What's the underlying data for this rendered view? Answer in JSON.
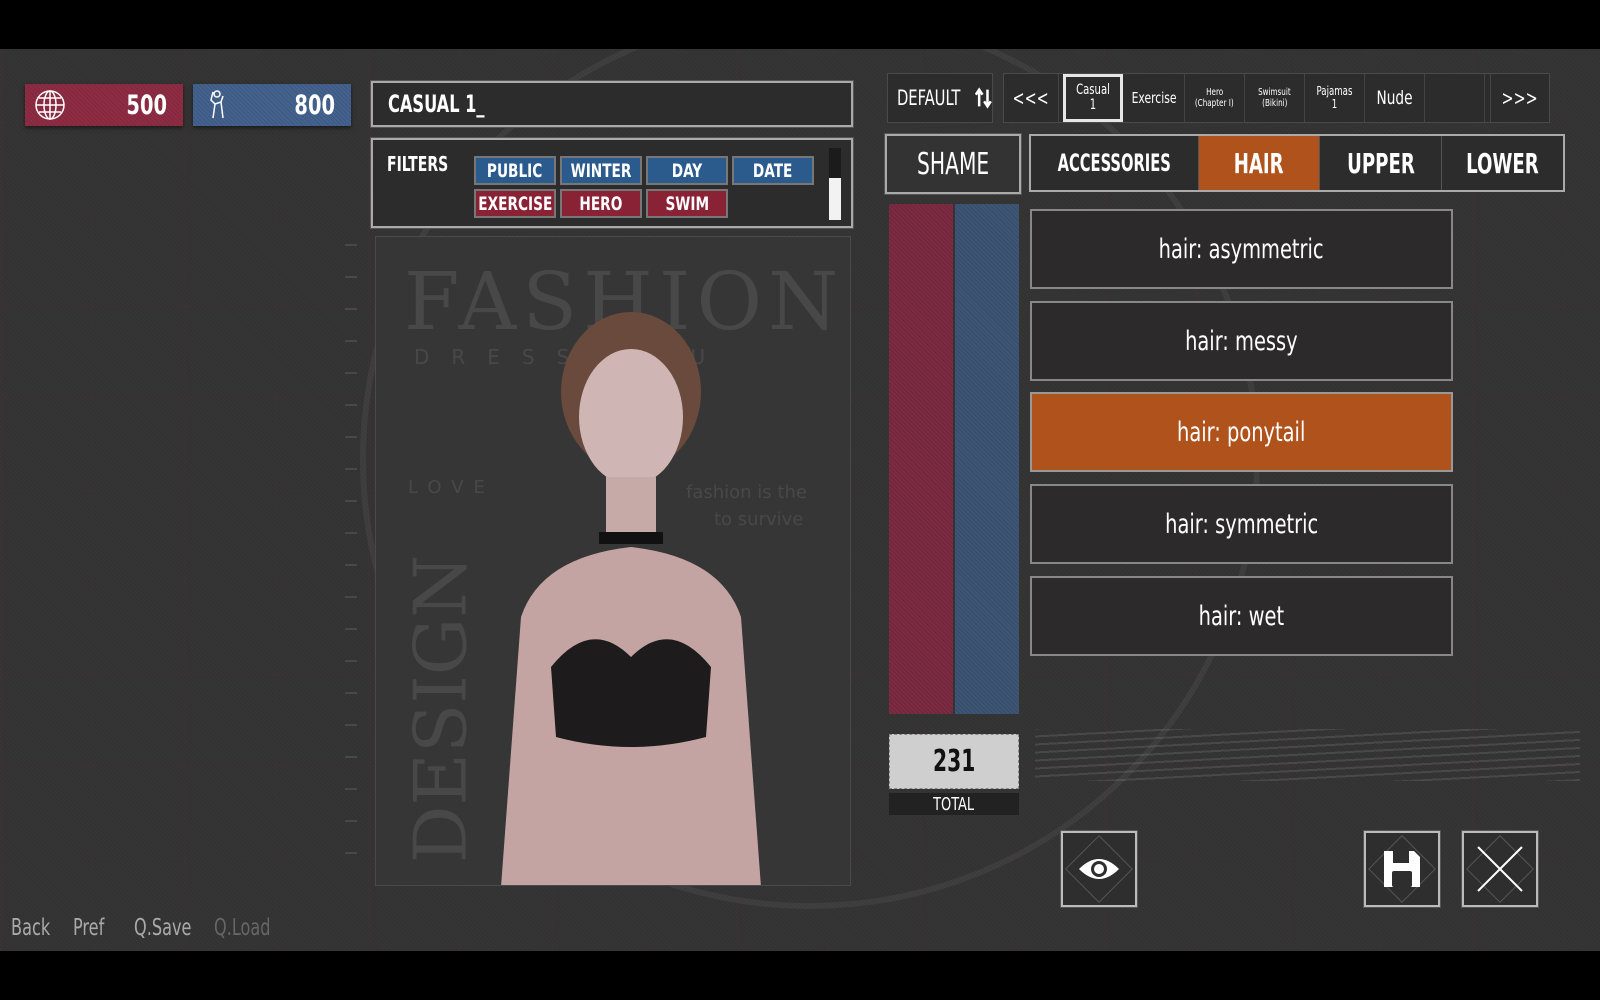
{
  "resources": [
    {
      "icon": "globe-icon",
      "value": "500",
      "color": "#8e2c44"
    },
    {
      "icon": "pose-figure-icon",
      "value": "800",
      "color": "#44628e"
    }
  ],
  "outfit_name": {
    "value": "CASUAL 1_"
  },
  "filters": {
    "label": "FILTERS",
    "chips": [
      {
        "label": "PUBLIC",
        "color": "blue"
      },
      {
        "label": "WINTER",
        "color": "blue"
      },
      {
        "label": "DAY",
        "color": "blue"
      },
      {
        "label": "DATE",
        "color": "blue"
      },
      {
        "label": "EXERCISE",
        "color": "red"
      },
      {
        "label": "HERO",
        "color": "red"
      },
      {
        "label": "SWIM",
        "color": "red"
      }
    ]
  },
  "preview": {
    "poster_title": "FASHION",
    "poster_subtitle": "DRESS YOU",
    "poster_love": "LOVE",
    "poster_design": "DESIGN",
    "poster_quote_1": "fashion is the",
    "poster_quote_2": "to survive",
    "figure_alt": "Character preview"
  },
  "sort": {
    "label": "DEFAULT",
    "icon": "sort-arrows-icon"
  },
  "outfit_tabs": {
    "prev_label": "<<<",
    "next_label": ">>>",
    "items": [
      {
        "line1": "Casual 1",
        "line2": "",
        "selected": true
      },
      {
        "line1": "Exercise",
        "line2": "",
        "selected": false
      },
      {
        "line1": "Hero",
        "line2": "(Chapter I)",
        "selected": false
      },
      {
        "line1": "Swimsuit",
        "line2": "(Bikini)",
        "selected": false
      },
      {
        "line1": "Pajamas",
        "line2": "1",
        "selected": false
      },
      {
        "line1": "Nude",
        "line2": "",
        "selected": false
      },
      {
        "line1": "",
        "line2": "",
        "selected": false
      }
    ]
  },
  "shame_label": "SHAME",
  "categories": [
    {
      "label": "ACCESSORIES",
      "active": false
    },
    {
      "label": "HAIR",
      "active": true
    },
    {
      "label": "UPPER",
      "active": false
    },
    {
      "label": "LOWER",
      "active": false
    }
  ],
  "meters": {
    "red_color": "#7c2b42",
    "blue_color": "#3e5676"
  },
  "total": {
    "value": "231",
    "label": "TOTAL"
  },
  "hair_options": [
    {
      "label": "hair: asymmetric",
      "selected": false
    },
    {
      "label": "hair: messy",
      "selected": false
    },
    {
      "label": "hair: ponytail",
      "selected": true
    },
    {
      "label": "hair: symmetric",
      "selected": false
    },
    {
      "label": "hair: wet",
      "selected": false
    }
  ],
  "actions": {
    "preview_icon": "eye-icon",
    "save_icon": "floppy-disk-icon",
    "close_icon": "close-x-icon"
  },
  "quick_menu": [
    {
      "label": "Back",
      "enabled": true
    },
    {
      "label": "Pref",
      "enabled": true
    },
    {
      "label": "Q.Save",
      "enabled": true
    },
    {
      "label": "Q.Load",
      "enabled": false
    }
  ],
  "colors": {
    "accent": "#b0521c",
    "filter_blue": "#2a5b8c",
    "filter_red": "#8a2236"
  }
}
